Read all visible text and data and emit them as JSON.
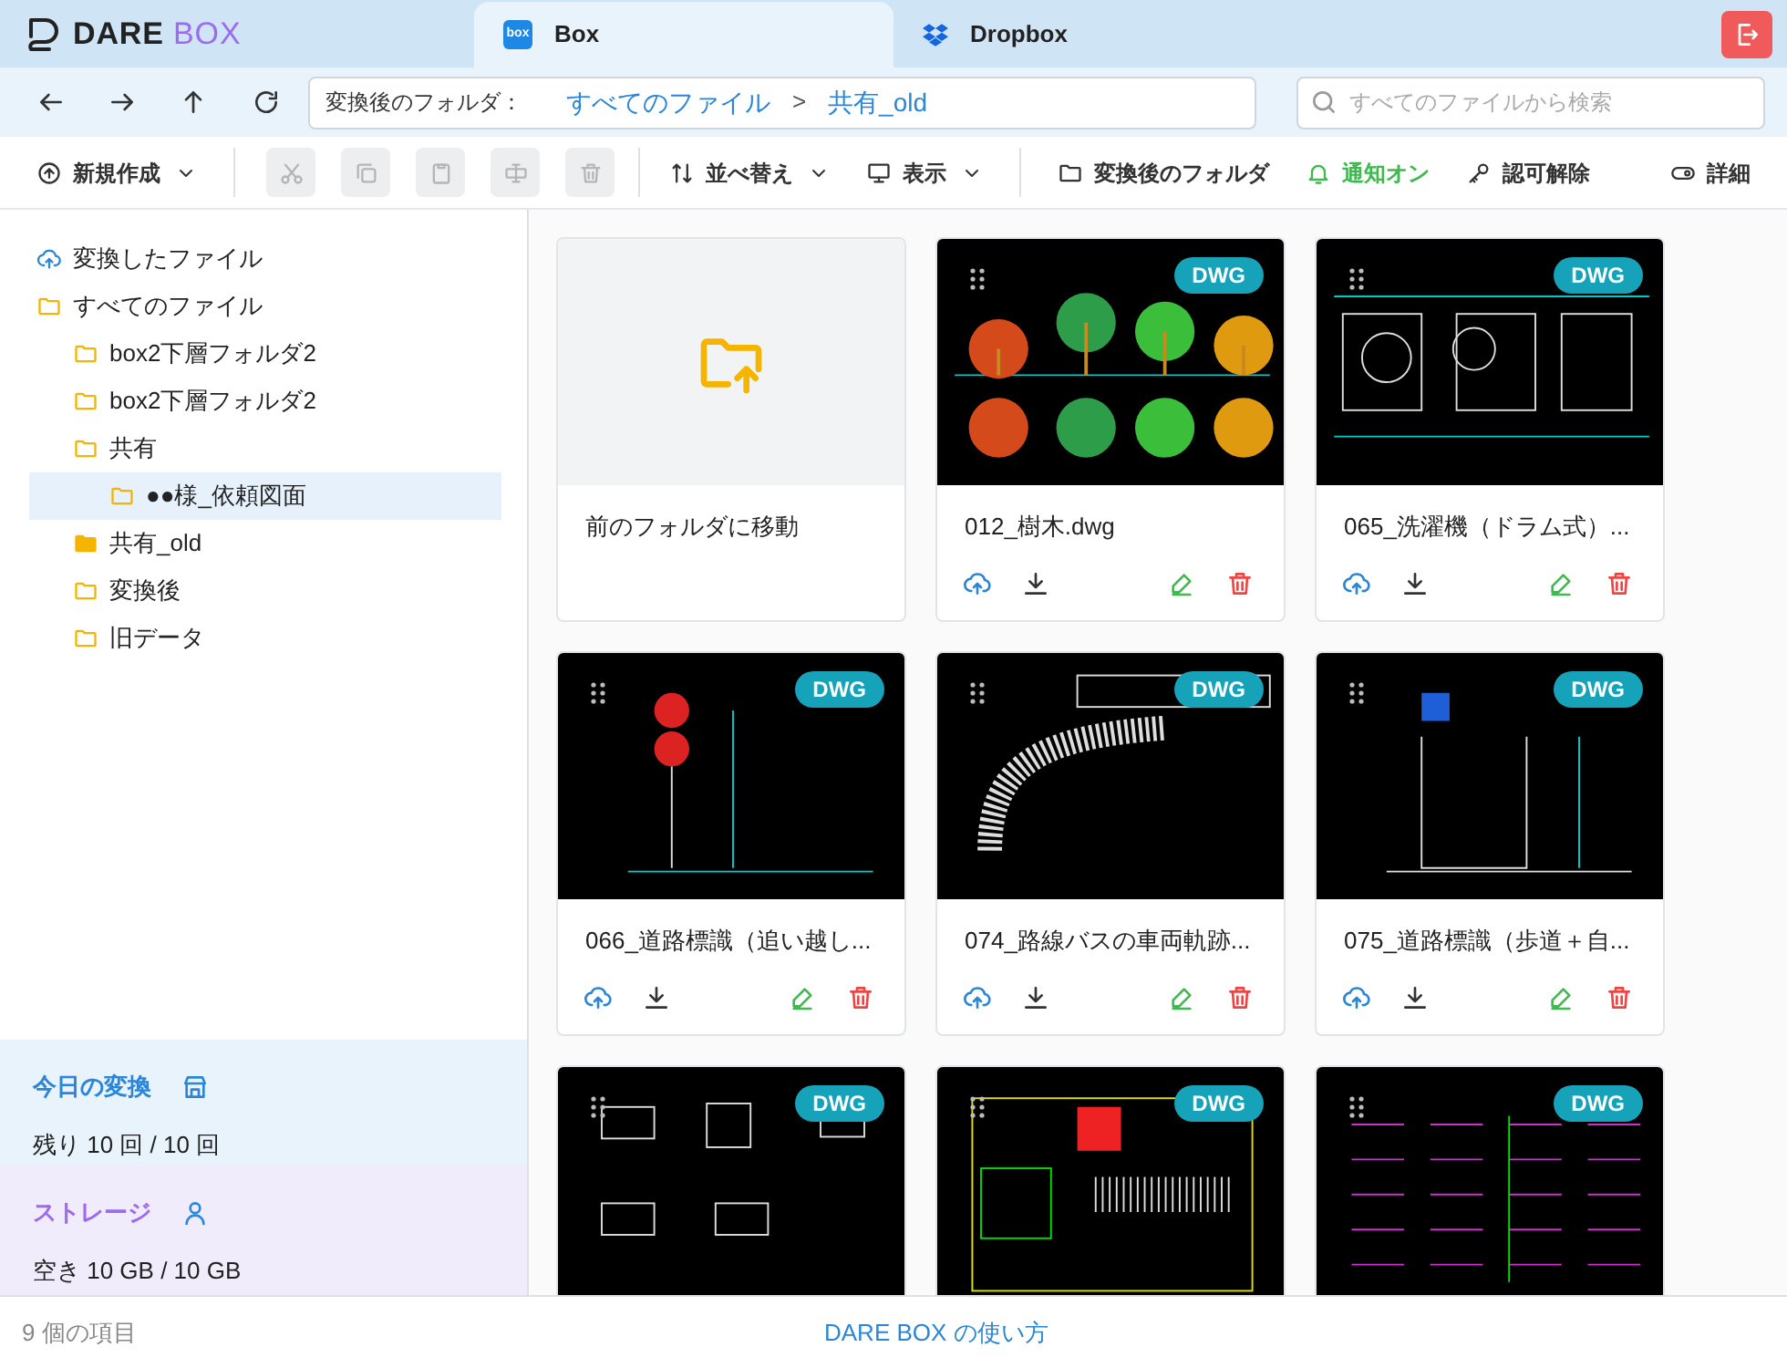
{
  "app": {
    "logo_left": "DARE",
    "logo_right": "BOX"
  },
  "tabs": [
    {
      "label": "Box",
      "logo_text": "box",
      "selected": true
    },
    {
      "label": "Dropbox",
      "selected": false
    }
  ],
  "nav": {
    "path_label": "変換後のフォルダ：",
    "breadcrumbs": [
      "すべてのファイル",
      "共有_old"
    ],
    "separator": ">",
    "search_placeholder": "すべてのファイルから検索"
  },
  "toolbar": [
    {
      "kind": "menu",
      "label": "新規作成",
      "disabled": false
    },
    {
      "kind": "icon",
      "disabled": true
    },
    {
      "kind": "icon",
      "disabled": true
    },
    {
      "kind": "icon",
      "disabled": true
    },
    {
      "kind": "icon",
      "disabled": true
    },
    {
      "kind": "icon",
      "disabled": true
    },
    {
      "kind": "menu",
      "label": "並べ替え",
      "disabled": false
    },
    {
      "kind": "menu",
      "label": "表示",
      "disabled": false
    },
    {
      "kind": "button",
      "label": "変換後のフォルダ",
      "disabled": false
    },
    {
      "kind": "toggle",
      "label": "通知オン",
      "on": true
    },
    {
      "kind": "button",
      "label": "認可解除",
      "disabled": false
    },
    {
      "kind": "details",
      "label": "詳細",
      "disabled": false
    }
  ],
  "sidebar": {
    "tree": [
      {
        "label": "変換したファイル",
        "kind": "converted",
        "selected": false
      },
      {
        "label": "すべてのファイル",
        "kind": "folder",
        "selected": false,
        "current": false,
        "children": [
          {
            "label": "box2下層フォルダ2",
            "kind": "folder",
            "selected": false,
            "current": false
          },
          {
            "label": "box2下層フォルダ2",
            "kind": "folder",
            "selected": false,
            "current": false
          },
          {
            "label": "共有",
            "kind": "folder",
            "selected": false,
            "current": false,
            "children": [
              {
                "label": "●●様_依頼図面",
                "kind": "folder",
                "selected": true,
                "current": false
              }
            ]
          },
          {
            "label": "共有_old",
            "kind": "folder",
            "selected": false,
            "current": true
          },
          {
            "label": "変換後",
            "kind": "folder",
            "selected": false,
            "current": false
          },
          {
            "label": "旧データ",
            "kind": "folder",
            "selected": false,
            "current": false
          }
        ]
      }
    ],
    "quota": {
      "title": "今日の変換",
      "text": "残り 10 回 / 10 回"
    },
    "storage": {
      "title": "ストレージ",
      "text": "空き 10 GB / 10 GB"
    }
  },
  "cards": [
    {
      "kind": "parent",
      "name": "前のフォルダに移動"
    },
    {
      "kind": "file",
      "name": "012_樹木.dwg",
      "badge": "DWG"
    },
    {
      "kind": "file",
      "name": "065_洗濯機（ドラム式）...",
      "badge": "DWG"
    },
    {
      "kind": "file",
      "name": "066_道路標識（追い越し...",
      "badge": "DWG"
    },
    {
      "kind": "file",
      "name": "074_路線バスの車両軌跡...",
      "badge": "DWG"
    },
    {
      "kind": "file",
      "name": "075_道路標識（歩道＋自...",
      "badge": "DWG"
    },
    {
      "kind": "file",
      "badge": "DWG"
    },
    {
      "kind": "file",
      "badge": "DWG"
    },
    {
      "kind": "file",
      "badge": "DWG"
    }
  ],
  "status_bar": {
    "count": "9 個の項目",
    "help_link": "DARE BOX の使い方"
  }
}
